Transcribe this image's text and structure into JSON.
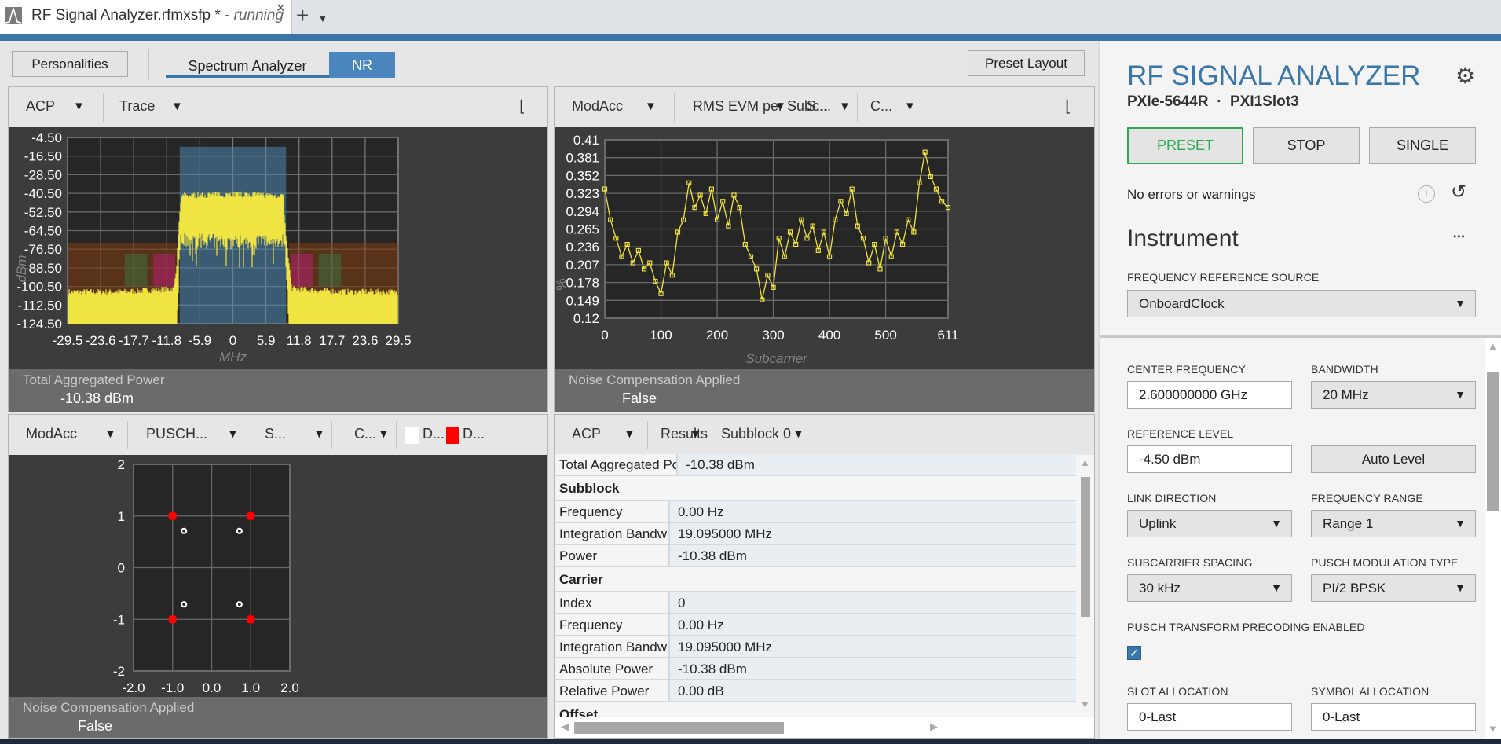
{
  "tab": {
    "title": "RF Signal Analyzer.rfmxsfp *",
    "status": "- running",
    "close": "×",
    "new": "+",
    "menu": "▼"
  },
  "toolbar": {
    "personalities": "Personalities",
    "tabs": [
      {
        "label": "Spectrum Analyzer",
        "active": false
      },
      {
        "label": "NR",
        "active": true
      }
    ],
    "preset_layout": "Preset Layout"
  },
  "panels": {
    "spectrum": {
      "measurement": "ACP",
      "view": "Trace",
      "footer_label": "Total Aggregated Power",
      "footer_value": "-10.38 dBm"
    },
    "evm": {
      "measurement": "ModAcc",
      "view": "RMS EVM per Subc...",
      "s": "S...",
      "c": "C...",
      "footer_label": "Noise Compensation Applied",
      "footer_value": "False"
    },
    "constellation": {
      "measurement": "ModAcc",
      "view": "PUSCH...",
      "s": "S...",
      "c": "C...",
      "legend": [
        {
          "label": "D...",
          "color": "#ffffff"
        },
        {
          "label": "D...",
          "color": "#ff0000"
        }
      ],
      "footer_label": "Noise Compensation Applied",
      "footer_value": "False"
    },
    "results": {
      "measurement": "ACP",
      "view": "Results",
      "subblock": "Subblock 0",
      "rows": [
        {
          "type": "kv",
          "key": "Total Aggregated Power",
          "value": "-10.38 dBm"
        },
        {
          "type": "section",
          "key": "Subblock"
        },
        {
          "type": "kv",
          "key": "Frequency",
          "value": "0.00 Hz"
        },
        {
          "type": "kv",
          "key": "Integration Bandwidth",
          "value": "19.095000 MHz"
        },
        {
          "type": "kv",
          "key": "Power",
          "value": "-10.38 dBm"
        },
        {
          "type": "section",
          "key": "Carrier"
        },
        {
          "type": "kv",
          "key": "Index",
          "value": "0"
        },
        {
          "type": "kv",
          "key": "Frequency",
          "value": "0.00 Hz"
        },
        {
          "type": "kv",
          "key": "Integration Bandwidth",
          "value": "19.095000 MHz"
        },
        {
          "type": "kv",
          "key": "Absolute Power",
          "value": "-10.38 dBm"
        },
        {
          "type": "kv",
          "key": "Relative Power",
          "value": "0.00 dB"
        },
        {
          "type": "section",
          "key": "Offset"
        }
      ]
    }
  },
  "chart_data": [
    {
      "type": "area",
      "ylabel": "dBm",
      "xlabel": "MHz",
      "xlim": [
        -29.5,
        29.5
      ],
      "ylim": [
        -124.5,
        -4.5
      ],
      "xticks": [
        "-29.5",
        "-23.6",
        "-17.7",
        "-11.8",
        "-5.9",
        "0",
        "5.9",
        "11.8",
        "17.7",
        "23.6",
        "29.5"
      ],
      "yticks": [
        "-4.50",
        "-16.50",
        "-28.50",
        "-40.50",
        "-52.50",
        "-64.50",
        "-76.50",
        "-88.50",
        "-100.50",
        "-112.50",
        "-124.50"
      ],
      "grid": true,
      "trace_color": "#f0e442",
      "regions": [
        {
          "kind": "carrier",
          "x": [
            -9.5,
            9.5
          ],
          "y": [
            -124.5,
            -10.5
          ],
          "color": "#4d86b0"
        },
        {
          "kind": "offset",
          "x": [
            -29.5,
            -10.0
          ],
          "y": [
            -124.5,
            -72.3
          ],
          "color": "#7a3a10"
        },
        {
          "kind": "offset",
          "x": [
            10.0,
            29.5
          ],
          "y": [
            -124.5,
            -72.3
          ],
          "color": "#7a3a10"
        },
        {
          "kind": "limit",
          "x": [
            -19.3,
            -15.3
          ],
          "y": [
            -100.5,
            -79.4
          ],
          "color": "#3e6a3a"
        },
        {
          "kind": "limit",
          "x": [
            -14.2,
            -10.3
          ],
          "y": [
            -100.5,
            -79.4
          ],
          "color": "#b0206a"
        },
        {
          "kind": "limit",
          "x": [
            10.3,
            14.2
          ],
          "y": [
            -100.5,
            -79.4
          ],
          "color": "#b0206a"
        },
        {
          "kind": "limit",
          "x": [
            15.3,
            19.3
          ],
          "y": [
            -100.5,
            -79.4
          ],
          "color": "#3e6a3a"
        }
      ],
      "trace_upper": {
        "x": [
          -29.5,
          -20,
          -10.5,
          -10.0,
          -9.6,
          -9.2,
          0,
          9.0,
          9.4,
          10.0,
          10.5,
          20,
          29.5
        ],
        "y": [
          -104,
          -104,
          -102,
          -85,
          -60,
          -42,
          -41,
          -42,
          -66,
          -85,
          -102,
          -104,
          -104
        ]
      },
      "trace_lower": {
        "x": [
          -29.5,
          -10.3,
          -10.0,
          -9.4,
          0,
          9.2,
          9.6,
          10.0,
          29.5
        ],
        "y": [
          -124.5,
          -124.5,
          -124.5,
          -73,
          -74,
          -73,
          -95,
          -124.5,
          -124.5
        ]
      }
    },
    {
      "type": "line",
      "ylabel": "%",
      "xlabel": "Subcarrier",
      "xlim": [
        0,
        611
      ],
      "ylim": [
        0.12,
        0.41
      ],
      "xticks": [
        "0",
        "100",
        "200",
        "300",
        "400",
        "500",
        "611"
      ],
      "yticks": [
        "0.41",
        "0.381",
        "0.352",
        "0.323",
        "0.294",
        "0.265",
        "0.236",
        "0.207",
        "0.178",
        "0.149",
        "0.12"
      ],
      "grid": true,
      "color": "#f0e442",
      "x": [
        0,
        10,
        20,
        30,
        40,
        50,
        60,
        70,
        80,
        90,
        100,
        110,
        120,
        130,
        140,
        150,
        160,
        170,
        180,
        190,
        200,
        210,
        220,
        230,
        240,
        250,
        260,
        270,
        280,
        290,
        300,
        310,
        320,
        330,
        340,
        350,
        360,
        370,
        380,
        390,
        400,
        410,
        420,
        430,
        440,
        450,
        460,
        470,
        480,
        490,
        500,
        510,
        520,
        530,
        540,
        550,
        560,
        570,
        580,
        590,
        600,
        611
      ],
      "y": [
        0.33,
        0.28,
        0.25,
        0.22,
        0.24,
        0.21,
        0.23,
        0.2,
        0.21,
        0.18,
        0.16,
        0.21,
        0.19,
        0.26,
        0.28,
        0.34,
        0.3,
        0.32,
        0.29,
        0.33,
        0.28,
        0.31,
        0.27,
        0.32,
        0.3,
        0.24,
        0.22,
        0.2,
        0.15,
        0.19,
        0.17,
        0.25,
        0.22,
        0.26,
        0.24,
        0.28,
        0.25,
        0.27,
        0.23,
        0.26,
        0.22,
        0.28,
        0.31,
        0.29,
        0.33,
        0.27,
        0.25,
        0.21,
        0.24,
        0.2,
        0.25,
        0.22,
        0.26,
        0.24,
        0.28,
        0.26,
        0.34,
        0.39,
        0.35,
        0.33,
        0.31,
        0.3
      ]
    },
    {
      "type": "scatter",
      "xlim": [
        -2,
        2
      ],
      "ylim": [
        -2,
        2
      ],
      "xticks": [
        "-2.0",
        "-1.0",
        "0.0",
        "1.0",
        "2.0"
      ],
      "yticks": [
        "2",
        "1",
        "0",
        "-1",
        "-2"
      ],
      "grid": true,
      "series": [
        {
          "color": "#ffffff",
          "x": [
            -0.71,
            0.71,
            -0.71,
            0.71
          ],
          "y": [
            0.71,
            0.71,
            -0.71,
            -0.71
          ]
        },
        {
          "color": "#ff0000",
          "x": [
            -1,
            1,
            -1,
            1
          ],
          "y": [
            1,
            1,
            -1,
            -1
          ]
        }
      ]
    }
  ],
  "instrument": {
    "title": "RF SIGNAL ANALYZER",
    "device": "PXIe-5644R",
    "separator": "·",
    "slot": "PXI1Slot3",
    "preset": "PRESET",
    "stop": "STOP",
    "single": "SINGLE",
    "status": "No errors or warnings",
    "section": "Instrument",
    "more": "•••",
    "freq_ref_label": "FREQUENCY REFERENCE SOURCE",
    "freq_ref_value": "OnboardClock",
    "center_freq_label": "CENTER FREQUENCY",
    "center_freq_value": "2.600000000 GHz",
    "bandwidth_label": "BANDWIDTH",
    "bandwidth_value": "20 MHz",
    "ref_level_label": "REFERENCE LEVEL",
    "ref_level_value": "-4.50 dBm",
    "auto_level": "Auto Level",
    "link_dir_label": "LINK DIRECTION",
    "link_dir_value": "Uplink",
    "freq_range_label": "FREQUENCY RANGE",
    "freq_range_value": "Range 1",
    "scs_label": "SUBCARRIER SPACING",
    "scs_value": "30 kHz",
    "mod_label": "PUSCH MODULATION TYPE",
    "mod_value": "PI/2 BPSK",
    "precoding_label": "PUSCH TRANSFORM PRECODING ENABLED",
    "precoding_checked": true,
    "slot_label": "SLOT ALLOCATION",
    "slot_value": "0-Last",
    "symbol_label": "SYMBOL ALLOCATION",
    "symbol_value": "0-Last",
    "accent": "#3a76a8",
    "preset_color": "#2fa84f"
  }
}
